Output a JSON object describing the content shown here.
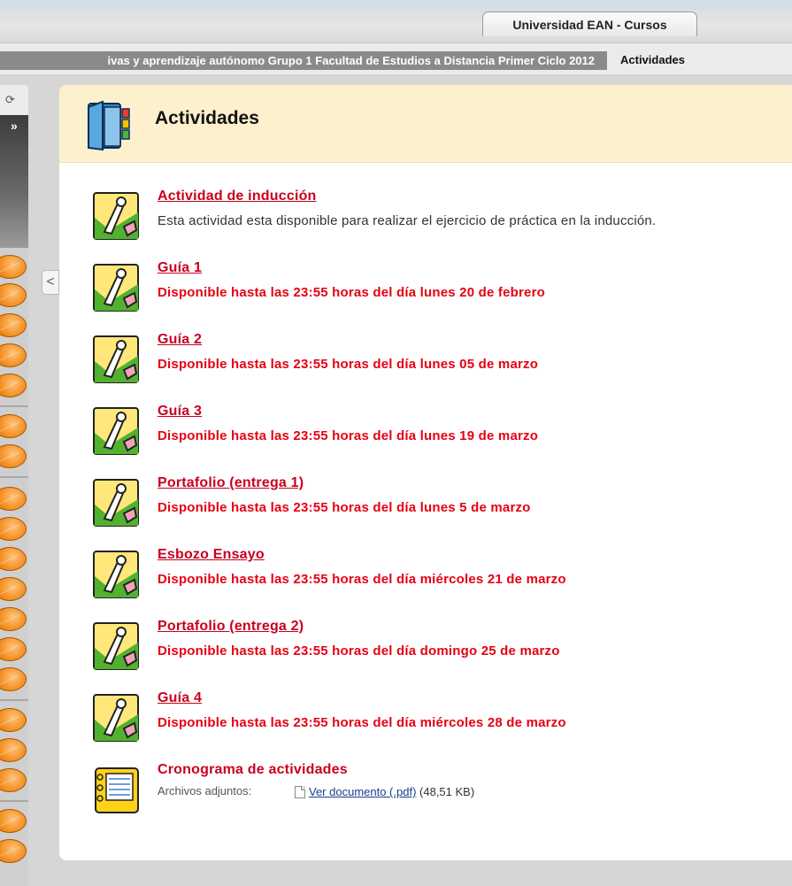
{
  "header": {
    "course_tab": "Universidad EAN - Cursos",
    "breadcrumb_course": "ivas y aprendizaje autónomo Grupo 1 Facultad de Estudios a Distancia Primer Ciclo 2012",
    "breadcrumb_current": "Actividades"
  },
  "nav": {
    "refresh_icon": "⟳",
    "expand_icon": "»",
    "collapse_icon": "<"
  },
  "page": {
    "title": "Actividades"
  },
  "items": [
    {
      "title": "Actividad de inducción",
      "desc": "Esta actividad esta disponible para realizar el ejercicio de práctica en la inducción."
    },
    {
      "title": "Guía 1",
      "desc": "Disponible hasta las 23:55 horas del día lunes 20 de febrero"
    },
    {
      "title": "Guía 2",
      "desc": "Disponible hasta las 23:55 horas del día lunes 05 de marzo"
    },
    {
      "title": "Guía 3",
      "desc": "Disponible hasta las 23:55 horas del día lunes 19 de marzo"
    },
    {
      "title": "Portafolio (entrega 1)",
      "desc": "Disponible hasta las 23:55 horas del día lunes 5 de marzo"
    },
    {
      "title": "Esbozo Ensayo",
      "desc": "Disponible hasta las 23:55 horas del día miércoles 21 de marzo"
    },
    {
      "title": "Portafolio (entrega 2)",
      "desc": "Disponible hasta las 23:55 horas del día domingo 25 de marzo"
    },
    {
      "title": "Guía 4",
      "desc": "Disponible hasta las 23:55 horas del día miércoles 28 de marzo"
    }
  ],
  "cronograma": {
    "title": "Cronograma de actividades",
    "attach_label": "Archivos adjuntos:",
    "file_link": "Ver documento (.pdf)",
    "file_size": "(48,51 KB)"
  },
  "colors": {
    "link_red": "#c8001e",
    "desc_red": "#e60012",
    "header_bg": "#fcf1cc"
  }
}
